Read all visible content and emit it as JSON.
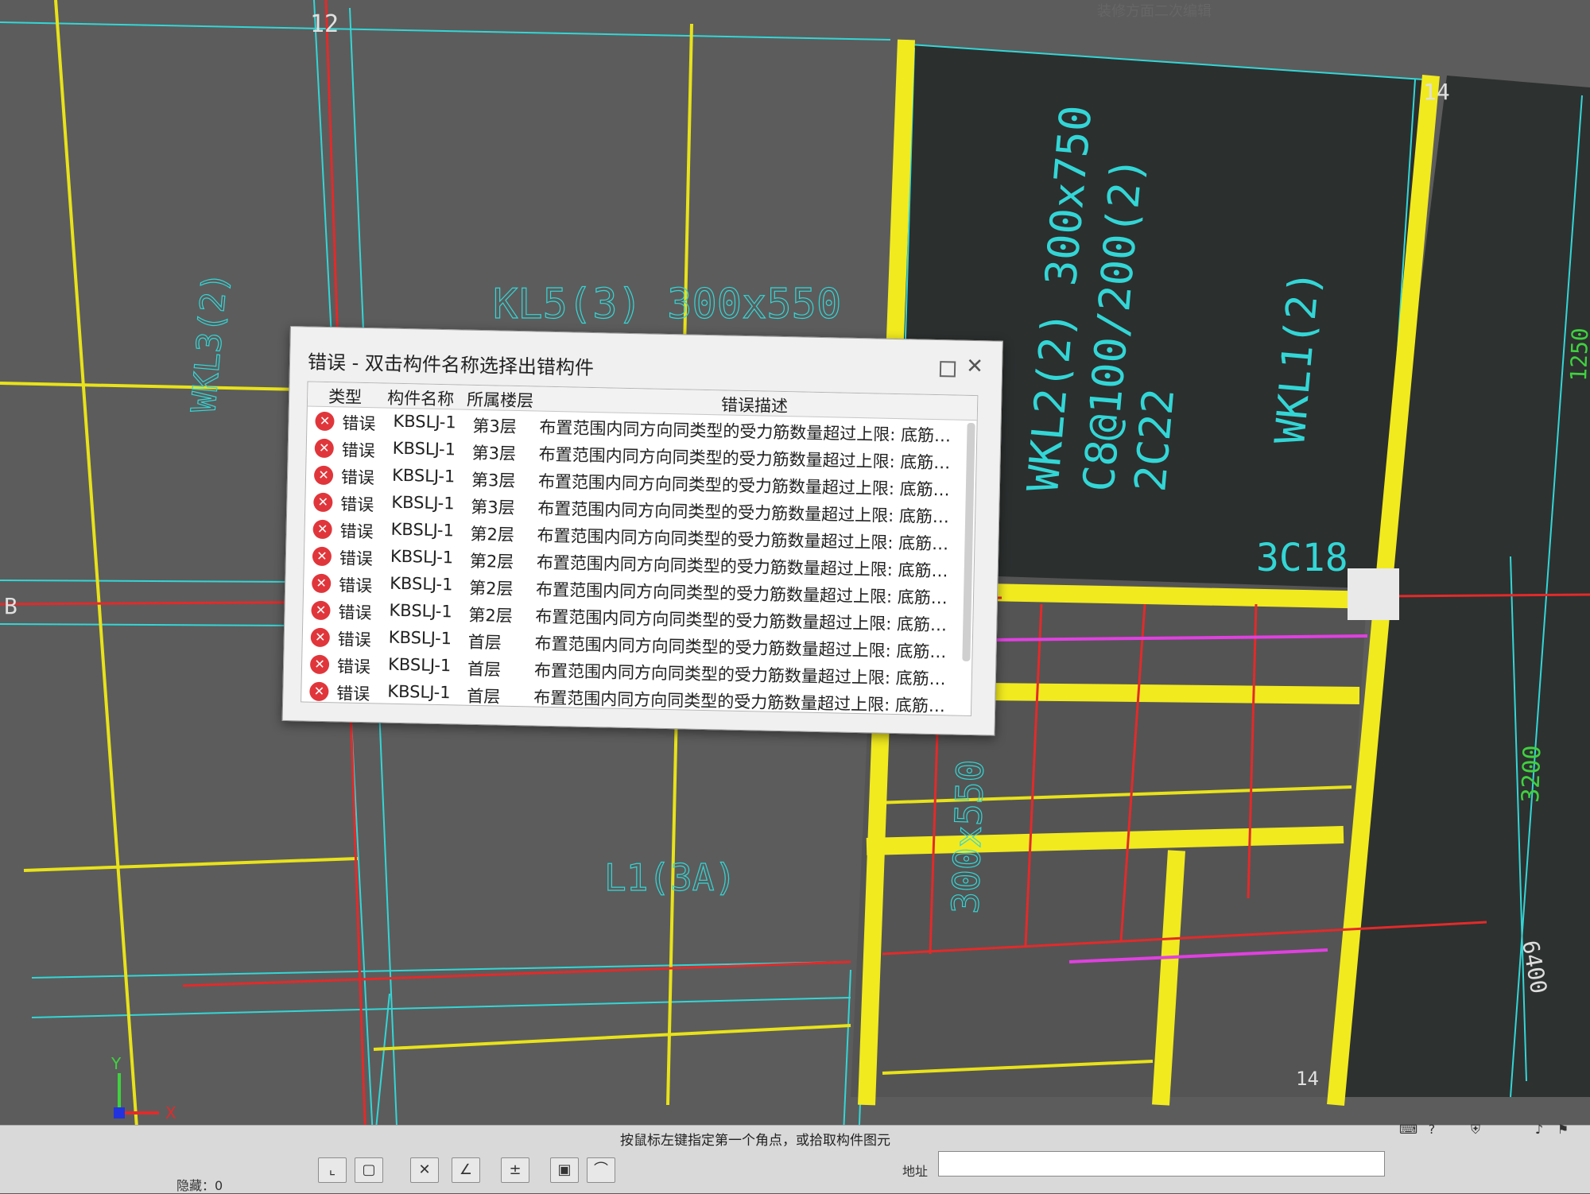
{
  "window_title_fragment": "装修方面二次编辑",
  "drawing": {
    "axis_labels": [
      "12",
      "14",
      "B",
      "12",
      "14"
    ],
    "beam_labels": [
      "KL5(3) 300x550",
      "WKL3(2)",
      "WKL2(2) 300x750",
      "C8@100/200(2)",
      "2C22",
      "WKL1(2)",
      "3C18",
      "L1(3A)",
      "300x550"
    ],
    "dimensions": [
      "3200",
      "6400",
      "1250"
    ],
    "ucs": {
      "x": "X",
      "y": "Y"
    }
  },
  "dialog": {
    "title": "错误 - 双击构件名称选择出错构件",
    "columns": [
      "类型",
      "构件名称",
      "所属楼层",
      "错误描述"
    ],
    "rows": [
      {
        "type": "错误",
        "name": "KBSLJ-1",
        "floor": "第3层",
        "desc": "布置范围内同方向同类型的受力筋数量超过上限: 底筋 ..."
      },
      {
        "type": "错误",
        "name": "KBSLJ-1",
        "floor": "第3层",
        "desc": "布置范围内同方向同类型的受力筋数量超过上限: 底筋 ..."
      },
      {
        "type": "错误",
        "name": "KBSLJ-1",
        "floor": "第3层",
        "desc": "布置范围内同方向同类型的受力筋数量超过上限: 底筋 ..."
      },
      {
        "type": "错误",
        "name": "KBSLJ-1",
        "floor": "第3层",
        "desc": "布置范围内同方向同类型的受力筋数量超过上限: 底筋 ..."
      },
      {
        "type": "错误",
        "name": "KBSLJ-1",
        "floor": "第2层",
        "desc": "布置范围内同方向同类型的受力筋数量超过上限: 底筋 ..."
      },
      {
        "type": "错误",
        "name": "KBSLJ-1",
        "floor": "第2层",
        "desc": "布置范围内同方向同类型的受力筋数量超过上限: 底筋 ..."
      },
      {
        "type": "错误",
        "name": "KBSLJ-1",
        "floor": "第2层",
        "desc": "布置范围内同方向同类型的受力筋数量超过上限: 底筋 ..."
      },
      {
        "type": "错误",
        "name": "KBSLJ-1",
        "floor": "第2层",
        "desc": "布置范围内同方向同类型的受力筋数量超过上限: 底筋 ..."
      },
      {
        "type": "错误",
        "name": "KBSLJ-1",
        "floor": "首层",
        "desc": "布置范围内同方向同类型的受力筋数量超过上限: 底筋 ..."
      },
      {
        "type": "错误",
        "name": "KBSLJ-1",
        "floor": "首层",
        "desc": "布置范围内同方向同类型的受力筋数量超过上限: 底筋 ..."
      },
      {
        "type": "错误",
        "name": "KBSLJ-1",
        "floor": "首层",
        "desc": "布置范围内同方向同类型的受力筋数量超过上限: 底筋 ..."
      }
    ]
  },
  "statusbar": {
    "prompt": "按鼠标左键指定第一个角点，或拾取构件图元",
    "hidden_label": "隐藏：0",
    "address_label": "地址"
  }
}
